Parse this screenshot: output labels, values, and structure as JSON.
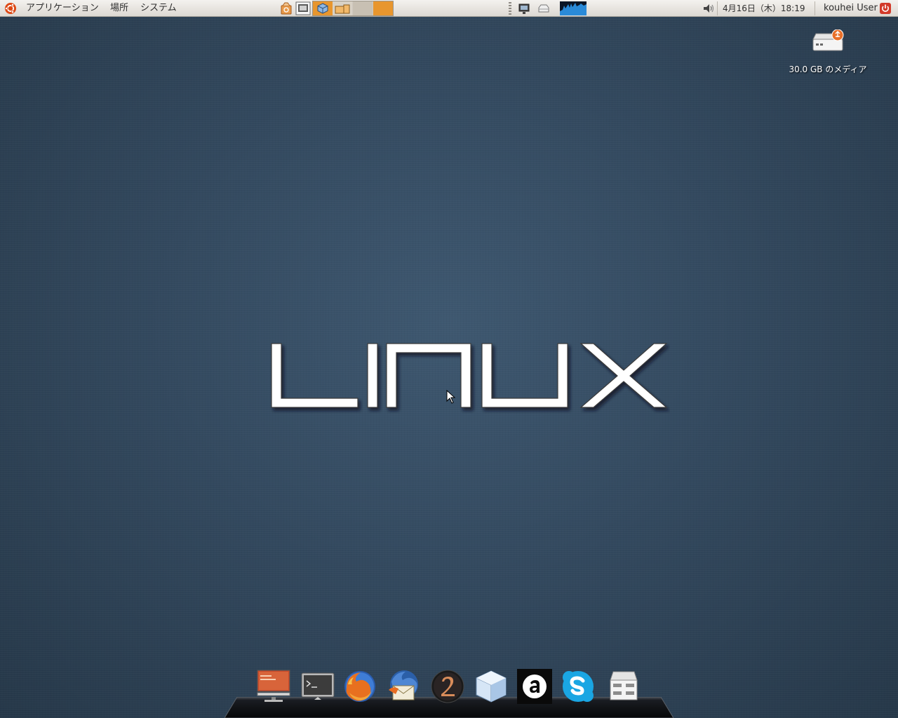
{
  "panel": {
    "menus": {
      "applications": "アプリケーション",
      "places": "場所",
      "system": "システム"
    },
    "clock": "4月16日（木）18:19",
    "user": "kouhei User"
  },
  "desktop": {
    "drive_label": "30.0 GB のメディア",
    "logo_text": "LINUX"
  },
  "dock": {
    "items": [
      "computer",
      "terminal",
      "firefox",
      "thunderbird",
      "opera",
      "virtualbox",
      "amarok",
      "skype",
      "file-manager"
    ]
  },
  "colors": {
    "panel_bg": "#e6e3de",
    "desktop_bg": "#33495f",
    "ubuntu_orange": "#dd4814",
    "accent_orange": "#e8962e"
  }
}
